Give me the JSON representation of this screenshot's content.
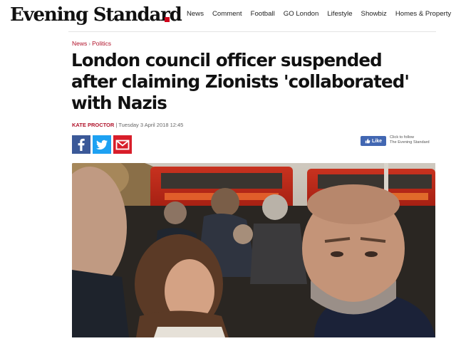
{
  "header": {
    "logo_text": "Evening Standard",
    "nav": [
      "News",
      "Comment",
      "Football",
      "GO London",
      "Lifestyle",
      "Showbiz",
      "Homes & Property"
    ]
  },
  "breadcrumb": {
    "section": "News",
    "subsection": "Politics"
  },
  "article": {
    "headline": "London council officer suspended after claiming Zionists 'collaborated' with Nazis",
    "author": "KATE PROCTOR",
    "date": "Tuesday 3 April 2018 12:45"
  },
  "share": {
    "icons": [
      "facebook-icon",
      "twitter-icon",
      "email-icon"
    ]
  },
  "like": {
    "label": "Like",
    "follow_line1": "Click to follow",
    "follow_line2": "The Evening Standard"
  },
  "colors": {
    "brand_red": "#b0122a",
    "logo_dot": "#d0021b",
    "facebook": "#3b5998",
    "twitter": "#1da1f2",
    "email": "#d81e2a",
    "like": "#4267b2"
  }
}
